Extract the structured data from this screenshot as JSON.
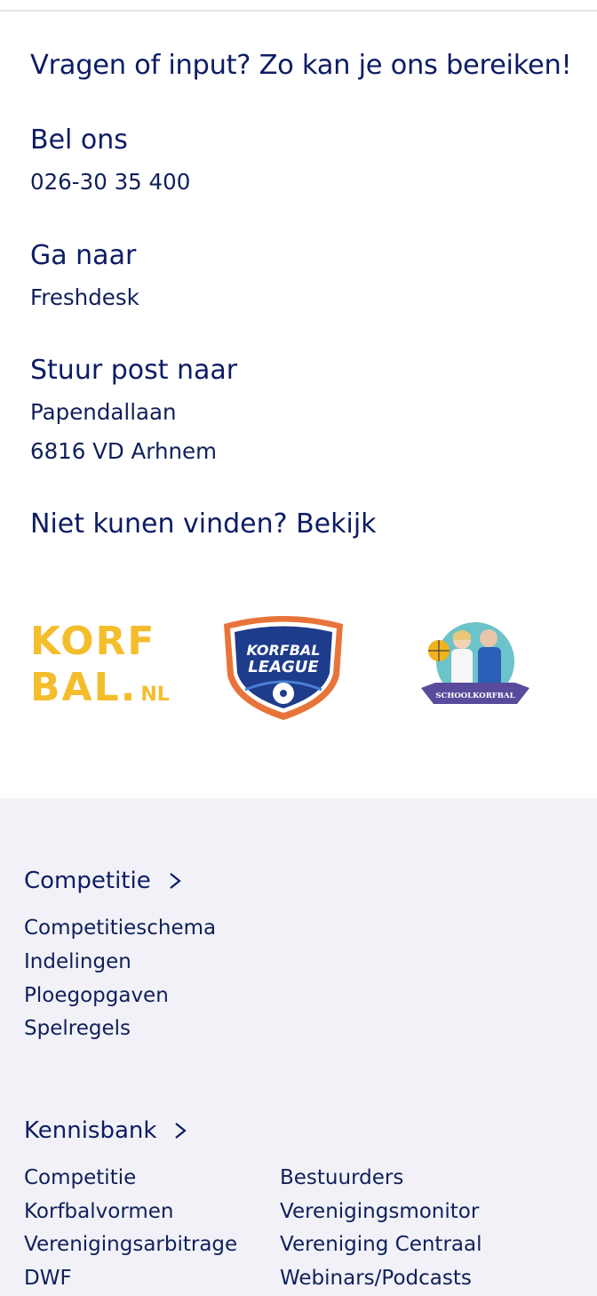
{
  "contact": {
    "heading": "Vragen of input? Zo kan je ons bereiken!",
    "call": {
      "title": "Bel ons",
      "phone": "026-30 35 400"
    },
    "goto": {
      "title": "Ga naar",
      "link": "Freshdesk"
    },
    "post": {
      "title": "Stuur post naar",
      "street": "Papendallaan",
      "city": "6816 VD Arhnem"
    },
    "notfound": "Niet kunen vinden? Bekijk"
  },
  "logos": {
    "korfbal_line1": "KORF",
    "korfbal_line2": "BAL.",
    "korfbal_nl": "NL",
    "league_line1": "KORFBAL",
    "league_line2": "LEAGUE",
    "school_label": "SCHOOLKORFBAL"
  },
  "footer": {
    "competitie": {
      "title": "Competitie",
      "links": [
        "Competitieschema",
        "Indelingen",
        "Ploegopgaven",
        "Spelregels"
      ]
    },
    "kennisbank": {
      "title": "Kennisbank",
      "col1": [
        "Competitie",
        "Korfbalvormen",
        "Verenigingsarbitrage",
        "DWF"
      ],
      "col2": [
        "Bestuurders",
        "Verenigingsmonitor",
        "Vereniging Centraal",
        "Webinars/Podcasts"
      ]
    }
  },
  "colors": {
    "navy": "#0d1c64",
    "korfbal_yellow": "#f4bd2c",
    "league_orange": "#e8743a",
    "league_blue": "#1e3c8c",
    "footer_bg": "#f1f1f7"
  }
}
